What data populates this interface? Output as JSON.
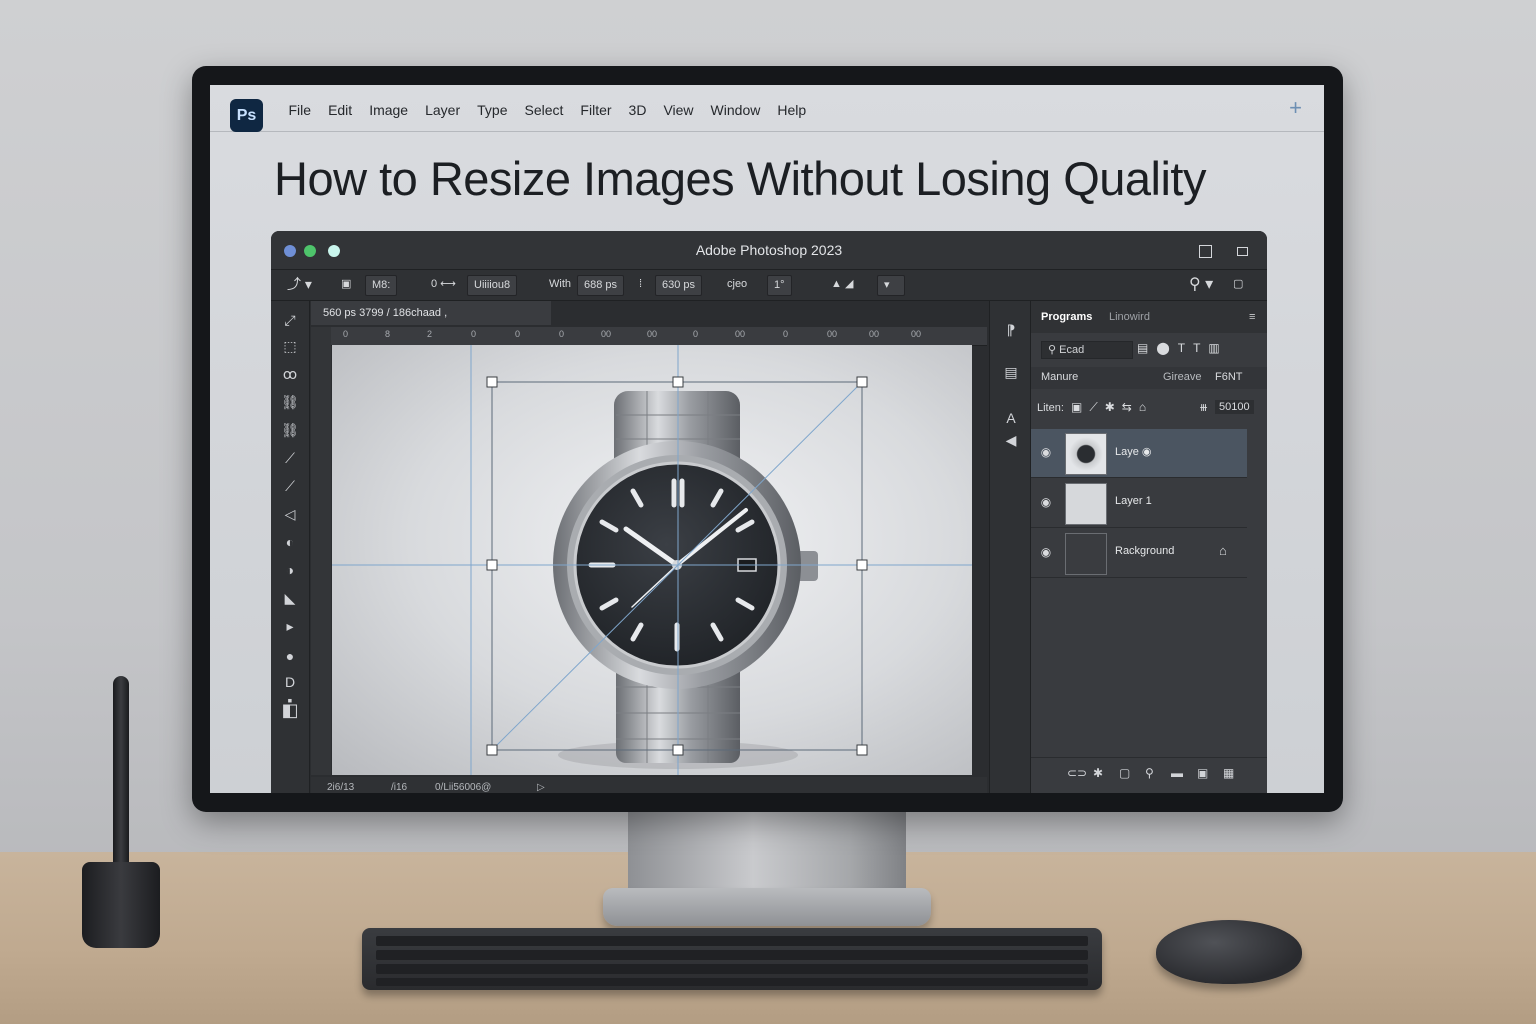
{
  "app": {
    "logo": "Ps",
    "menu": [
      "File",
      "Edit",
      "Image",
      "Layer",
      "Type",
      "Select",
      "Filter",
      "3D",
      "View",
      "Window",
      "Help"
    ],
    "new_tab_icon": "plus-icon"
  },
  "page": {
    "headline": "How to Resize Images Without Losing Quality"
  },
  "photoshop": {
    "window_title": "Adobe Photoshop 2023",
    "options": {
      "preset": "M8:",
      "mode": "Uiiiiou8",
      "width_label": "With",
      "width_value": "688 ps",
      "height_value": "630 ps",
      "angle_label": "cjeo",
      "angle_value": "1°"
    },
    "doc_tab": "560 ps  3799 / 186chaad ,",
    "ruler_ticks": [
      "0",
      "8",
      "2",
      "0",
      "0",
      "0",
      "00",
      "00",
      "0",
      "00",
      "0",
      "00",
      "00",
      "00"
    ],
    "status": {
      "zoom": "2i6/13",
      "info_a": "/i16",
      "info_b": "0/Lii56006@"
    },
    "panel": {
      "tabs": [
        "Programs",
        "Linowird"
      ],
      "active_tab": "Programs",
      "search_placeholder": "Ecad",
      "blend_mode": "Manure",
      "fill_label": "Gireave",
      "fill_value": "F6NT",
      "lock_label": "Liten:",
      "opacity_value": "50100",
      "layers": [
        {
          "name": "Laye",
          "selected": true
        },
        {
          "name": "Layer 1",
          "selected": false
        },
        {
          "name": "Rackground",
          "selected": false,
          "locked": true
        }
      ]
    }
  },
  "colors": {
    "ps_logo_bg": "#0f2742",
    "ps_logo_text": "#c8e1ff",
    "selection_guide": "#7fa6cc",
    "selected_layer": "#4b5561",
    "traffic_blue": "#6f8fd6",
    "traffic_green": "#4ec46b",
    "traffic_mint": "#c9f5ec"
  }
}
